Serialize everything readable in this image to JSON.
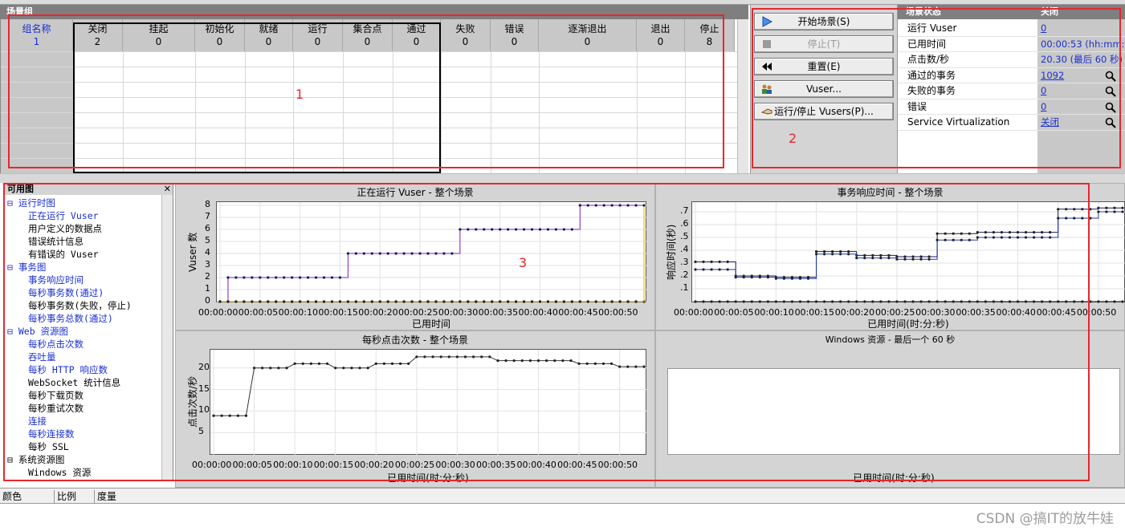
{
  "scenario_groups": {
    "title": "场景组",
    "columns": [
      "组名称",
      "关闭",
      "挂起",
      "初始化",
      "就绪",
      "运行",
      "集合点",
      "通过",
      "失败",
      "错误",
      "逐渐退出",
      "退出",
      "停止"
    ],
    "values": [
      "1",
      "2",
      "0",
      "0",
      "0",
      "0",
      "0",
      "0",
      "0",
      "0",
      "0",
      "0",
      "8"
    ]
  },
  "controls": {
    "start": "开始场景(S)",
    "stop": "停止(T)",
    "reset": "重置(E)",
    "vusers": "Vuser...",
    "run_stop": "运行/停止 Vusers(P)..."
  },
  "status": {
    "title": "场景状态",
    "state": "关闭",
    "rows": [
      {
        "k": "运行 Vuser",
        "v": "0"
      },
      {
        "k": "已用时间",
        "v": "00:00:53 (hh:mm:ss)"
      },
      {
        "k": "点击数/秒",
        "v": "20.30 (最后 60 秒)"
      },
      {
        "k": "通过的事务",
        "v": "1092"
      },
      {
        "k": "失败的事务",
        "v": "0"
      },
      {
        "k": "错误",
        "v": "0"
      },
      {
        "k": "Service Virtualization",
        "v": "关闭"
      }
    ]
  },
  "tree": {
    "title": "可用图",
    "items": [
      {
        "label": "运行时图",
        "level": 0,
        "link": true
      },
      {
        "label": "正在运行 Vuser",
        "level": 1,
        "link": true
      },
      {
        "label": "用户定义的数据点",
        "level": 1,
        "link": false
      },
      {
        "label": "错误统计信息",
        "level": 1,
        "link": false
      },
      {
        "label": "有错误的 Vuser",
        "level": 1,
        "link": false
      },
      {
        "label": "事务图",
        "level": 0,
        "link": true
      },
      {
        "label": "事务响应时间",
        "level": 1,
        "link": true
      },
      {
        "label": "每秒事务数(通过)",
        "level": 1,
        "link": true
      },
      {
        "label": "每秒事务数(失败，停止)",
        "level": 1,
        "link": false
      },
      {
        "label": "每秒事务总数(通过)",
        "level": 1,
        "link": true
      },
      {
        "label": "Web 资源图",
        "level": 0,
        "link": true
      },
      {
        "label": "每秒点击次数",
        "level": 1,
        "link": true
      },
      {
        "label": "吞吐量",
        "level": 1,
        "link": true
      },
      {
        "label": "每秒 HTTP 响应数",
        "level": 1,
        "link": true
      },
      {
        "label": "WebSocket 统计信息",
        "level": 1,
        "link": false
      },
      {
        "label": "每秒下载页数",
        "level": 1,
        "link": false
      },
      {
        "label": "每秒重试次数",
        "level": 1,
        "link": false
      },
      {
        "label": "连接",
        "level": 1,
        "link": true
      },
      {
        "label": "每秒连接数",
        "level": 1,
        "link": true
      },
      {
        "label": "每秒 SSL",
        "level": 1,
        "link": false
      },
      {
        "label": "系统资源图",
        "level": 0,
        "link": false
      },
      {
        "label": "Windows 资源",
        "level": 1,
        "link": false
      }
    ]
  },
  "chart_data": [
    {
      "type": "line",
      "title": "正在运行 Vuser - 整个场景",
      "xlabel": "已用时间",
      "ylabel": "Vuser 数",
      "x_ticks": [
        "00:00:00",
        "00:00:05",
        "00:00:10",
        "00:00:15",
        "00:00:20",
        "00:00:25",
        "00:00:30",
        "00:00:35",
        "00:00:40",
        "00:00:45",
        "00:00:50"
      ],
      "y_ticks": [
        "0",
        "1",
        "2",
        "3",
        "4",
        "5",
        "6",
        "7",
        "8"
      ],
      "ylim": [
        0,
        8
      ],
      "xlim": [
        0,
        53
      ],
      "x": [
        0,
        1,
        2,
        3,
        4,
        5,
        6,
        7,
        8,
        9,
        10,
        11,
        12,
        13,
        14,
        15,
        16,
        17,
        18,
        19,
        20,
        21,
        22,
        23,
        24,
        25,
        26,
        27,
        28,
        29,
        30,
        31,
        32,
        33,
        34,
        35,
        36,
        37,
        38,
        39,
        40,
        41,
        42,
        43,
        44,
        45,
        46,
        47,
        48,
        49,
        50,
        51,
        52,
        53
      ],
      "series": [
        {
          "name": "",
          "color": "#8020c0",
          "values": [
            0,
            2,
            2,
            2,
            2,
            2,
            2,
            2,
            2,
            2,
            2,
            2,
            2,
            2,
            2,
            2,
            4,
            4,
            4,
            4,
            4,
            4,
            4,
            4,
            4,
            4,
            4,
            4,
            4,
            4,
            6,
            6,
            6,
            6,
            6,
            6,
            6,
            6,
            6,
            6,
            6,
            6,
            6,
            6,
            6,
            8,
            8,
            8,
            8,
            8,
            8,
            8,
            8,
            0
          ]
        },
        {
          "name": "",
          "color": "#2a2aa0",
          "values": [
            0,
            0,
            0,
            0,
            0,
            0,
            0,
            0,
            0,
            0,
            0,
            0,
            0,
            0,
            0,
            0,
            0,
            0,
            0,
            0,
            0,
            0,
            0,
            0,
            0,
            0,
            0,
            0,
            0,
            0,
            0,
            0,
            0,
            0,
            0,
            0,
            0,
            0,
            0,
            0,
            0,
            0,
            0,
            0,
            0,
            0,
            0,
            0,
            0,
            0,
            0,
            0,
            0,
            0
          ]
        },
        {
          "name": "",
          "color": "#e0b000",
          "values": [
            0,
            0,
            0,
            0,
            0,
            0,
            0,
            0,
            0,
            0,
            0,
            0,
            0,
            0,
            0,
            0,
            0,
            0,
            0,
            0,
            0,
            0,
            0,
            0,
            0,
            0,
            0,
            0,
            0,
            0,
            0,
            0,
            0,
            0,
            0,
            0,
            0,
            0,
            0,
            0,
            0,
            0,
            0,
            0,
            0,
            0,
            0,
            0,
            0,
            0,
            0,
            0,
            0,
            8
          ]
        }
      ]
    },
    {
      "type": "line",
      "title": "事务响应时间 - 整个场景",
      "xlabel": "已用时间(时:分:秒)",
      "ylabel": "响应时间(秒)",
      "x_ticks": [
        "00:00:00",
        "00:00:05",
        "00:00:10",
        "00:00:15",
        "00:00:20",
        "00:00:25",
        "00:00:30",
        "00:00:35",
        "00:00:40",
        "00:00:45",
        "00:00:50"
      ],
      "y_ticks": [
        ".1",
        ".2",
        ".3",
        ".4",
        ".5",
        ".6",
        ".7"
      ],
      "ylim": [
        0,
        0.75
      ],
      "xlim": [
        0,
        53
      ],
      "x": [
        0,
        1,
        2,
        3,
        4,
        5,
        6,
        7,
        8,
        9,
        10,
        11,
        12,
        13,
        14,
        15,
        16,
        17,
        18,
        19,
        20,
        21,
        22,
        23,
        24,
        25,
        26,
        27,
        28,
        29,
        30,
        31,
        32,
        33,
        34,
        35,
        36,
        37,
        38,
        39,
        40,
        41,
        42,
        43,
        44,
        45,
        46,
        47,
        48,
        49,
        50,
        51,
        52,
        53
      ],
      "series": [
        {
          "name": "",
          "color": "#1a1a5a",
          "values": [
            0.31,
            0.31,
            0.31,
            0.31,
            0.31,
            0.2,
            0.2,
            0.2,
            0.2,
            0.2,
            0.19,
            0.19,
            0.19,
            0.19,
            0.19,
            0.39,
            0.39,
            0.39,
            0.39,
            0.39,
            0.36,
            0.36,
            0.36,
            0.36,
            0.36,
            0.35,
            0.35,
            0.35,
            0.35,
            0.35,
            0.53,
            0.53,
            0.53,
            0.53,
            0.53,
            0.54,
            0.54,
            0.54,
            0.54,
            0.54,
            0.54,
            0.54,
            0.54,
            0.54,
            0.54,
            0.72,
            0.72,
            0.72,
            0.72,
            0.72,
            0.73,
            0.73,
            0.73,
            0.73
          ]
        },
        {
          "name": "",
          "color": "#1a3ab0",
          "values": [
            0.25,
            0.25,
            0.25,
            0.25,
            0.25,
            0.19,
            0.19,
            0.19,
            0.19,
            0.19,
            0.18,
            0.18,
            0.18,
            0.18,
            0.18,
            0.37,
            0.37,
            0.37,
            0.37,
            0.37,
            0.34,
            0.34,
            0.34,
            0.34,
            0.34,
            0.33,
            0.33,
            0.33,
            0.33,
            0.33,
            0.48,
            0.48,
            0.48,
            0.48,
            0.48,
            0.5,
            0.5,
            0.5,
            0.5,
            0.5,
            0.5,
            0.5,
            0.5,
            0.5,
            0.5,
            0.65,
            0.65,
            0.65,
            0.65,
            0.65,
            0.7,
            0.7,
            0.7,
            0.7
          ]
        },
        {
          "name": "",
          "color": "#222222",
          "values": [
            0,
            0,
            0,
            0,
            0,
            0,
            0,
            0,
            0,
            0,
            0,
            0,
            0,
            0,
            0,
            0,
            0,
            0,
            0,
            0,
            0,
            0,
            0,
            0,
            0,
            0,
            0,
            0,
            0,
            0,
            0,
            0,
            0,
            0,
            0,
            0,
            0,
            0,
            0,
            0,
            0,
            0,
            0,
            0,
            0,
            0,
            0,
            0,
            0,
            0,
            0,
            0,
            0,
            0
          ]
        }
      ]
    },
    {
      "type": "line",
      "title": "每秒点击次数 - 整个场景",
      "xlabel": "已用时间(时:分:秒)",
      "ylabel": "点击次数/秒",
      "x_ticks": [
        "00:00:00",
        "00:00:05",
        "00:00:10",
        "00:00:15",
        "00:00:20",
        "00:00:25",
        "00:00:30",
        "00:00:35",
        "00:00:40",
        "00:00:45",
        "00:00:50"
      ],
      "y_ticks": [
        "5",
        "10",
        "15",
        "20"
      ],
      "ylim": [
        0,
        23.5
      ],
      "xlim": [
        0,
        53
      ],
      "x": [
        0,
        1,
        2,
        3,
        4,
        5,
        6,
        7,
        8,
        9,
        10,
        11,
        12,
        13,
        14,
        15,
        16,
        17,
        18,
        19,
        20,
        21,
        22,
        23,
        24,
        25,
        26,
        27,
        28,
        29,
        30,
        31,
        32,
        33,
        34,
        35,
        36,
        37,
        38,
        39,
        40,
        41,
        42,
        43,
        44,
        45,
        46,
        47,
        48,
        49,
        50,
        51,
        52,
        53
      ],
      "series": [
        {
          "name": "",
          "color": "#333333",
          "values": [
            8.9,
            8.9,
            8.9,
            8.9,
            8.9,
            20,
            20,
            20,
            20,
            20,
            21,
            21,
            21,
            21,
            21,
            20,
            20,
            20,
            20,
            20,
            21,
            21,
            21,
            21,
            21,
            22.6,
            22.6,
            22.6,
            22.6,
            22.6,
            22.6,
            22.6,
            22.6,
            22.6,
            22.6,
            21.7,
            21.7,
            21.7,
            21.7,
            21.7,
            21.7,
            21.7,
            21.7,
            21.7,
            21.7,
            21,
            21,
            21,
            21,
            21,
            20.3,
            20.3,
            20.3,
            20.3
          ]
        }
      ]
    },
    {
      "type": "line",
      "title": "Windows 资源 - 最后一个 60 秒",
      "xlabel": "已用时间(时:分:秒)",
      "series": []
    }
  ],
  "annotations": [
    "1",
    "2",
    "3"
  ],
  "footer": {
    "tabs": [
      "颜色",
      "比例",
      "度量"
    ]
  },
  "watermark": "CSDN @搞IT的放牛娃"
}
